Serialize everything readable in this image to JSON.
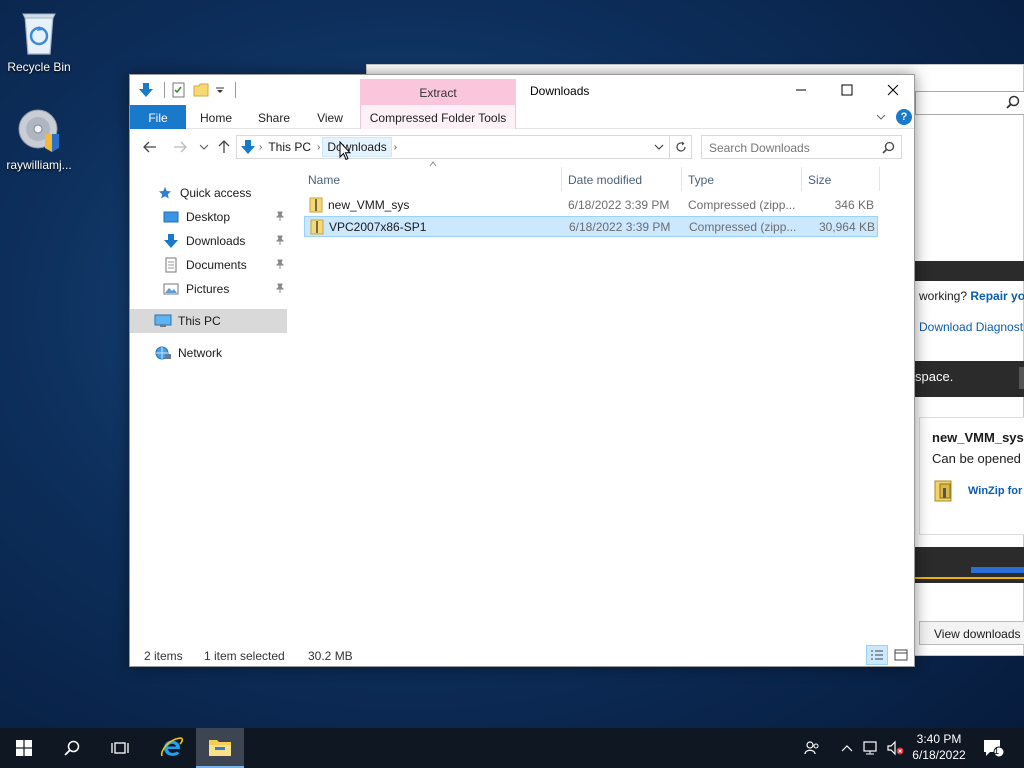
{
  "desktop": {
    "icons": [
      {
        "label": "Recycle Bin",
        "icon": "recycle-bin-icon"
      },
      {
        "label": "raywilliamj...",
        "icon": "disc-installer-icon"
      }
    ]
  },
  "background_window": {
    "help_text": "working?",
    "repair_link": "Repair you",
    "download_diag_link": "Download Diagnosti",
    "space_text": "space.",
    "file_name": "new_VMM_sys.",
    "can_be_opened": "Can be opened v",
    "winzip_label": "WinZip for",
    "view_downloads": "View downloads"
  },
  "explorer": {
    "contextual_tab": "Extract",
    "window_title": "Downloads",
    "ribbon_tabs": [
      "File",
      "Home",
      "Share",
      "View",
      "Compressed Folder Tools"
    ],
    "breadcrumb": [
      "This PC",
      "Downloads"
    ],
    "search_placeholder": "Search Downloads",
    "nav": {
      "quick_access": "Quick access",
      "items": [
        {
          "label": "Desktop",
          "icon": "desktop-folder-icon",
          "pinned": true
        },
        {
          "label": "Downloads",
          "icon": "downloads-folder-icon",
          "pinned": true
        },
        {
          "label": "Documents",
          "icon": "documents-folder-icon",
          "pinned": true
        },
        {
          "label": "Pictures",
          "icon": "pictures-folder-icon",
          "pinned": true
        }
      ],
      "this_pc": "This PC",
      "network": "Network"
    },
    "columns": [
      "Name",
      "Date modified",
      "Type",
      "Size"
    ],
    "files": [
      {
        "name": "new_VMM_sys",
        "date": "6/18/2022 3:39 PM",
        "type": "Compressed (zipp...",
        "size": "346 KB",
        "selected": false
      },
      {
        "name": "VPC2007x86-SP1",
        "date": "6/18/2022 3:39 PM",
        "type": "Compressed (zipp...",
        "size": "30,964 KB",
        "selected": true
      }
    ],
    "status": {
      "items": "2 items",
      "selected": "1 item selected",
      "size": "30.2 MB"
    },
    "colors": {
      "accent": "#1979ca",
      "contextual": "#f9c6dc",
      "selection": "#cce8ff"
    }
  },
  "taskbar": {
    "time": "3:40 PM",
    "date": "6/18/2022",
    "notification_count": "1"
  }
}
